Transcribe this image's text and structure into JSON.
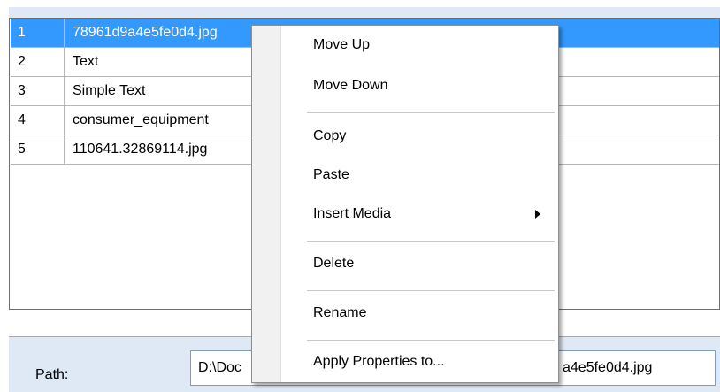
{
  "media_list": {
    "rows": [
      {
        "num": "1",
        "name": "78961d9a4e5fe0d4.jpg",
        "selected": true
      },
      {
        "num": "2",
        "name": "Text",
        "selected": false
      },
      {
        "num": "3",
        "name": "Simple Text",
        "selected": false
      },
      {
        "num": "4",
        "name": "consumer_equipment",
        "selected": false
      },
      {
        "num": "5",
        "name": "110641.32869114.jpg",
        "selected": false
      }
    ]
  },
  "path": {
    "label": "Path:",
    "value_start": "D:\\Doc",
    "value_end": "a4e5fe0d4.jpg"
  },
  "context_menu": {
    "move_up": "Move Up",
    "move_down": "Move Down",
    "copy": "Copy",
    "paste": "Paste",
    "insert_media": "Insert Media",
    "delete": "Delete",
    "rename": "Rename",
    "apply_properties": "Apply Properties to..."
  },
  "colors": {
    "selection": "#3399ff",
    "panel_background": "#dfe9f5"
  }
}
